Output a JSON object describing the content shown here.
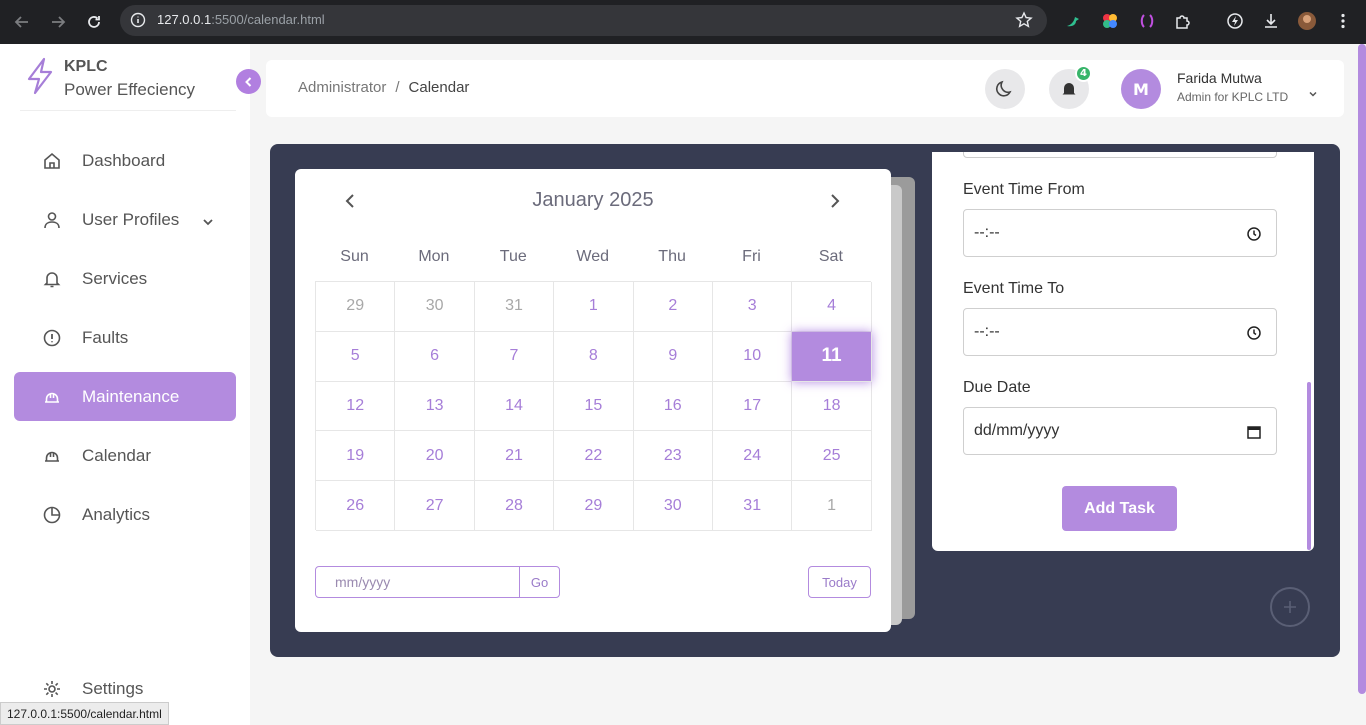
{
  "browser": {
    "url_host": "127.0.0.1",
    "url_path": ":5500/calendar.html"
  },
  "brand": {
    "line1": "KPLC",
    "line2": "Power Effeciency"
  },
  "sidebar": {
    "items": [
      {
        "label": "Dashboard",
        "icon": "home-icon"
      },
      {
        "label": "User Profiles",
        "icon": "user-icon"
      },
      {
        "label": "Services",
        "icon": "bell-icon"
      },
      {
        "label": "Faults",
        "icon": "alert-circle-icon"
      },
      {
        "label": "Maintenance",
        "icon": "helmet-icon",
        "active": true
      },
      {
        "label": "Calendar",
        "icon": "helmet-icon"
      },
      {
        "label": "Analytics",
        "icon": "pie-chart-icon"
      }
    ],
    "settings_label": "Settings"
  },
  "header": {
    "crumb_root": "Administrator",
    "crumb_sep": "/",
    "crumb_current": "Calendar",
    "notif_count": "4",
    "avatar_initial": "M",
    "user_name": "Farida Mutwa",
    "user_role": "Admin for KPLC LTD"
  },
  "calendar": {
    "month_title": "January 2025",
    "weekdays": [
      "Sun",
      "Mon",
      "Tue",
      "Wed",
      "Thu",
      "Fri",
      "Sat"
    ],
    "days": [
      [
        "29",
        "30",
        "31",
        "1",
        "2",
        "3",
        "4"
      ],
      [
        "5",
        "6",
        "7",
        "8",
        "9",
        "10",
        "11"
      ],
      [
        "12",
        "13",
        "14",
        "15",
        "16",
        "17",
        "18"
      ],
      [
        "19",
        "20",
        "21",
        "22",
        "23",
        "24",
        "25"
      ],
      [
        "26",
        "27",
        "28",
        "29",
        "30",
        "31",
        "1"
      ]
    ],
    "selected_day": "11",
    "month_placeholder": "mm/yyyy",
    "go_label": "Go",
    "today_label": "Today"
  },
  "form": {
    "time_from_label": "Event Time From",
    "time_from_value": "--:--",
    "time_to_label": "Event Time To",
    "time_to_value": "--:--",
    "due_label": "Due Date",
    "due_value": "dd/mm/yyyy",
    "submit_label": "Add Task"
  },
  "status_url": "127.0.0.1:5500/calendar.html",
  "colors": {
    "accent": "#b38bdf",
    "panel": "#373c52"
  }
}
